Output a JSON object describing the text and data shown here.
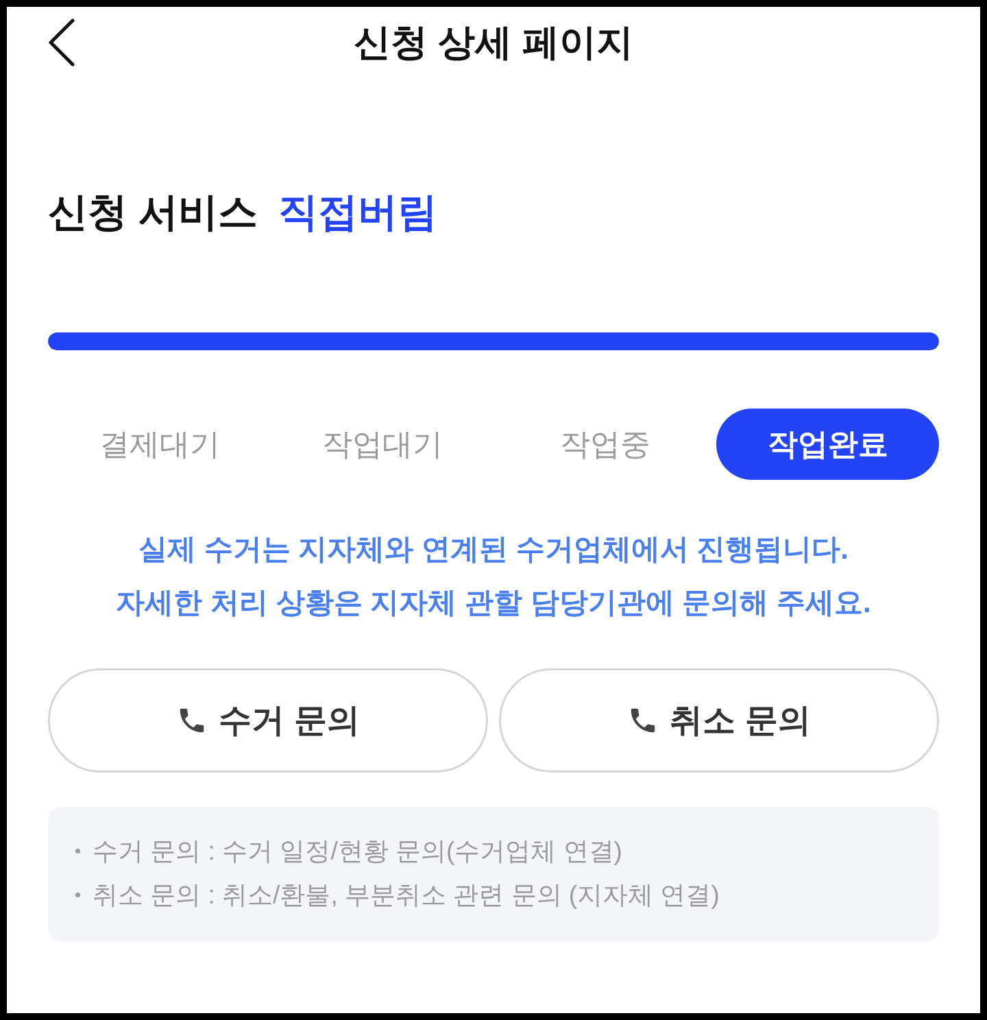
{
  "header": {
    "title": "신청 상세 페이지"
  },
  "service": {
    "label": "신청 서비스",
    "value": "직접버림"
  },
  "progress": {
    "level": 1
  },
  "steps": [
    {
      "label": "결제대기",
      "selected": false
    },
    {
      "label": "작업대기",
      "selected": false
    },
    {
      "label": "작업중",
      "selected": false
    },
    {
      "label": "작업완료",
      "selected": true
    }
  ],
  "notice": [
    "실제 수거는 지자체와 연계된 수거업체에서 진행됩니다.",
    "자세한 처리 상황은 지자체 관할 담당기관에 문의해 주세요."
  ],
  "buttons": [
    {
      "label": "수거 문의"
    },
    {
      "label": "취소 문의"
    }
  ],
  "notes": [
    "수거 문의 : 수거 일정/현황 문의(수거업체 연결)",
    "취소 문의 : 취소/환불, 부분취소 관련 문의 (지자체 연결)"
  ]
}
